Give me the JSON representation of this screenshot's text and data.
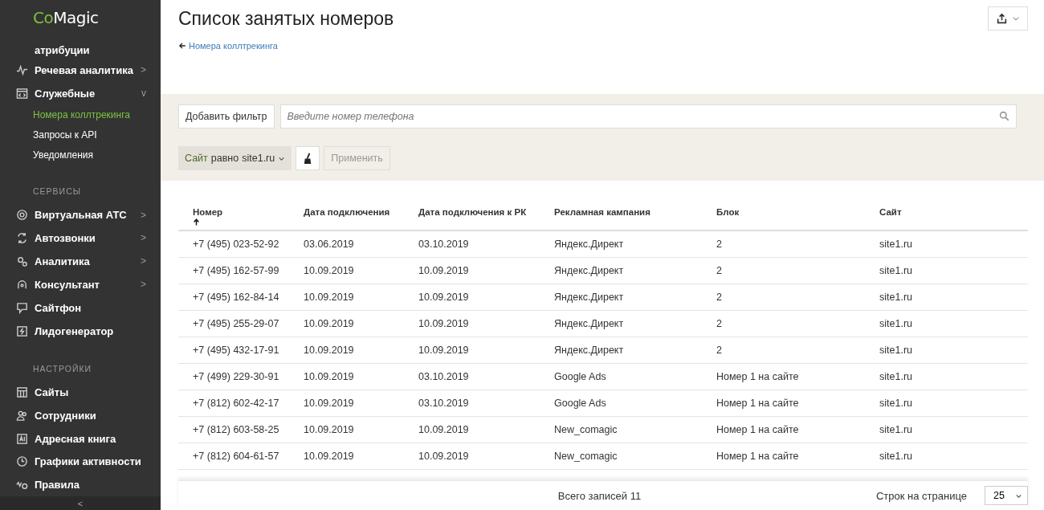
{
  "sidebar": {
    "logo": {
      "part1": "Co",
      "part2": "Magic"
    },
    "top_item": "атрибуции",
    "items": [
      {
        "label": "Речевая аналитика",
        "chevron": ">"
      },
      {
        "label": "Служебные",
        "chevron": "v",
        "expanded": true,
        "children": [
          {
            "label": "Номера коллтрекинга",
            "selected": true
          },
          {
            "label": "Запросы к API",
            "selected": false
          },
          {
            "label": "Уведомления",
            "selected": false
          }
        ]
      }
    ],
    "sections": [
      {
        "title": "СЕРВИСЫ",
        "items": [
          {
            "label": "Виртуальная АТС",
            "chevron": ">"
          },
          {
            "label": "Автозвонки",
            "chevron": ">"
          },
          {
            "label": "Аналитика",
            "chevron": ">"
          },
          {
            "label": "Консультант",
            "chevron": ">"
          },
          {
            "label": "Сайтфон"
          },
          {
            "label": "Лидогенератор"
          }
        ]
      },
      {
        "title": "НАСТРОЙКИ",
        "items": [
          {
            "label": "Сайты"
          },
          {
            "label": "Сотрудники"
          },
          {
            "label": "Адресная книга"
          },
          {
            "label": "Графики активности"
          },
          {
            "label": "Правила"
          }
        ]
      }
    ],
    "collapse": "<"
  },
  "page": {
    "title": "Список занятых номеров",
    "back_link": "Номера коллтрекинга"
  },
  "filters": {
    "add_button": "Добавить фильтр",
    "search": {
      "placeholder": "Введите номер телефона"
    },
    "chip": {
      "field": "Сайт",
      "operator": "равно",
      "value": "site1.ru"
    },
    "apply_button": {
      "label": "Применить",
      "disabled": true
    }
  },
  "table": {
    "columns": [
      {
        "label": "Номер",
        "sorted": true
      },
      {
        "label": "Дата подключения",
        "sorted": false
      },
      {
        "label": "Дата подключения к РК",
        "sorted": false
      },
      {
        "label": "Рекламная кампания",
        "sorted": false
      },
      {
        "label": "Блок",
        "sorted": false
      },
      {
        "label": "Сайт",
        "sorted": false
      }
    ],
    "rows": [
      [
        "+7 (495) 023-52-92",
        "03.06.2019",
        "03.10.2019",
        "Яндекс.Директ",
        "2",
        "site1.ru"
      ],
      [
        "+7 (495) 162-57-99",
        "10.09.2019",
        "10.09.2019",
        "Яндекс.Директ",
        "2",
        "site1.ru"
      ],
      [
        "+7 (495) 162-84-14",
        "10.09.2019",
        "10.09.2019",
        "Яндекс.Директ",
        "2",
        "site1.ru"
      ],
      [
        "+7 (495) 255-29-07",
        "10.09.2019",
        "10.09.2019",
        "Яндекс.Директ",
        "2",
        "site1.ru"
      ],
      [
        "+7 (495) 432-17-91",
        "10.09.2019",
        "10.09.2019",
        "Яндекс.Директ",
        "2",
        "site1.ru"
      ],
      [
        "+7 (499) 229-30-91",
        "10.09.2019",
        "03.10.2019",
        "Google Ads",
        "Номер 1 на сайте",
        "site1.ru"
      ],
      [
        "+7 (812) 602-42-17",
        "10.09.2019",
        "03.10.2019",
        "Google Ads",
        "Номер 1 на сайте",
        "site1.ru"
      ],
      [
        "+7 (812) 603-58-25",
        "10.09.2019",
        "10.09.2019",
        "New_comagic",
        "Номер 1 на сайте",
        "site1.ru"
      ],
      [
        "+7 (812) 604-61-57",
        "10.09.2019",
        "10.09.2019",
        "New_comagic",
        "Номер 1 на сайте",
        "site1.ru"
      ]
    ]
  },
  "footer": {
    "total": "Всего записей 11",
    "per_page_label": "Строк на странице",
    "per_page": "25"
  }
}
